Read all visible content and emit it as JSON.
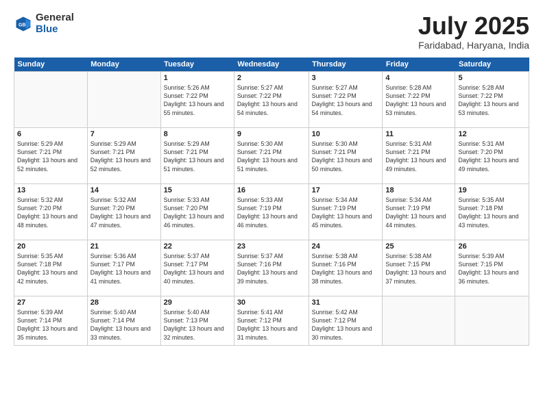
{
  "logo": {
    "general": "General",
    "blue": "Blue"
  },
  "title": "July 2025",
  "location": "Faridabad, Haryana, India",
  "weekdays": [
    "Sunday",
    "Monday",
    "Tuesday",
    "Wednesday",
    "Thursday",
    "Friday",
    "Saturday"
  ],
  "weeks": [
    [
      {
        "day": "",
        "info": ""
      },
      {
        "day": "",
        "info": ""
      },
      {
        "day": "1",
        "info": "Sunrise: 5:26 AM\nSunset: 7:22 PM\nDaylight: 13 hours and 55 minutes."
      },
      {
        "day": "2",
        "info": "Sunrise: 5:27 AM\nSunset: 7:22 PM\nDaylight: 13 hours and 54 minutes."
      },
      {
        "day": "3",
        "info": "Sunrise: 5:27 AM\nSunset: 7:22 PM\nDaylight: 13 hours and 54 minutes."
      },
      {
        "day": "4",
        "info": "Sunrise: 5:28 AM\nSunset: 7:22 PM\nDaylight: 13 hours and 53 minutes."
      },
      {
        "day": "5",
        "info": "Sunrise: 5:28 AM\nSunset: 7:22 PM\nDaylight: 13 hours and 53 minutes."
      }
    ],
    [
      {
        "day": "6",
        "info": "Sunrise: 5:29 AM\nSunset: 7:21 PM\nDaylight: 13 hours and 52 minutes."
      },
      {
        "day": "7",
        "info": "Sunrise: 5:29 AM\nSunset: 7:21 PM\nDaylight: 13 hours and 52 minutes."
      },
      {
        "day": "8",
        "info": "Sunrise: 5:29 AM\nSunset: 7:21 PM\nDaylight: 13 hours and 51 minutes."
      },
      {
        "day": "9",
        "info": "Sunrise: 5:30 AM\nSunset: 7:21 PM\nDaylight: 13 hours and 51 minutes."
      },
      {
        "day": "10",
        "info": "Sunrise: 5:30 AM\nSunset: 7:21 PM\nDaylight: 13 hours and 50 minutes."
      },
      {
        "day": "11",
        "info": "Sunrise: 5:31 AM\nSunset: 7:21 PM\nDaylight: 13 hours and 49 minutes."
      },
      {
        "day": "12",
        "info": "Sunrise: 5:31 AM\nSunset: 7:20 PM\nDaylight: 13 hours and 49 minutes."
      }
    ],
    [
      {
        "day": "13",
        "info": "Sunrise: 5:32 AM\nSunset: 7:20 PM\nDaylight: 13 hours and 48 minutes."
      },
      {
        "day": "14",
        "info": "Sunrise: 5:32 AM\nSunset: 7:20 PM\nDaylight: 13 hours and 47 minutes."
      },
      {
        "day": "15",
        "info": "Sunrise: 5:33 AM\nSunset: 7:20 PM\nDaylight: 13 hours and 46 minutes."
      },
      {
        "day": "16",
        "info": "Sunrise: 5:33 AM\nSunset: 7:19 PM\nDaylight: 13 hours and 46 minutes."
      },
      {
        "day": "17",
        "info": "Sunrise: 5:34 AM\nSunset: 7:19 PM\nDaylight: 13 hours and 45 minutes."
      },
      {
        "day": "18",
        "info": "Sunrise: 5:34 AM\nSunset: 7:19 PM\nDaylight: 13 hours and 44 minutes."
      },
      {
        "day": "19",
        "info": "Sunrise: 5:35 AM\nSunset: 7:18 PM\nDaylight: 13 hours and 43 minutes."
      }
    ],
    [
      {
        "day": "20",
        "info": "Sunrise: 5:35 AM\nSunset: 7:18 PM\nDaylight: 13 hours and 42 minutes."
      },
      {
        "day": "21",
        "info": "Sunrise: 5:36 AM\nSunset: 7:17 PM\nDaylight: 13 hours and 41 minutes."
      },
      {
        "day": "22",
        "info": "Sunrise: 5:37 AM\nSunset: 7:17 PM\nDaylight: 13 hours and 40 minutes."
      },
      {
        "day": "23",
        "info": "Sunrise: 5:37 AM\nSunset: 7:16 PM\nDaylight: 13 hours and 39 minutes."
      },
      {
        "day": "24",
        "info": "Sunrise: 5:38 AM\nSunset: 7:16 PM\nDaylight: 13 hours and 38 minutes."
      },
      {
        "day": "25",
        "info": "Sunrise: 5:38 AM\nSunset: 7:15 PM\nDaylight: 13 hours and 37 minutes."
      },
      {
        "day": "26",
        "info": "Sunrise: 5:39 AM\nSunset: 7:15 PM\nDaylight: 13 hours and 36 minutes."
      }
    ],
    [
      {
        "day": "27",
        "info": "Sunrise: 5:39 AM\nSunset: 7:14 PM\nDaylight: 13 hours and 35 minutes."
      },
      {
        "day": "28",
        "info": "Sunrise: 5:40 AM\nSunset: 7:14 PM\nDaylight: 13 hours and 33 minutes."
      },
      {
        "day": "29",
        "info": "Sunrise: 5:40 AM\nSunset: 7:13 PM\nDaylight: 13 hours and 32 minutes."
      },
      {
        "day": "30",
        "info": "Sunrise: 5:41 AM\nSunset: 7:12 PM\nDaylight: 13 hours and 31 minutes."
      },
      {
        "day": "31",
        "info": "Sunrise: 5:42 AM\nSunset: 7:12 PM\nDaylight: 13 hours and 30 minutes."
      },
      {
        "day": "",
        "info": ""
      },
      {
        "day": "",
        "info": ""
      }
    ]
  ]
}
